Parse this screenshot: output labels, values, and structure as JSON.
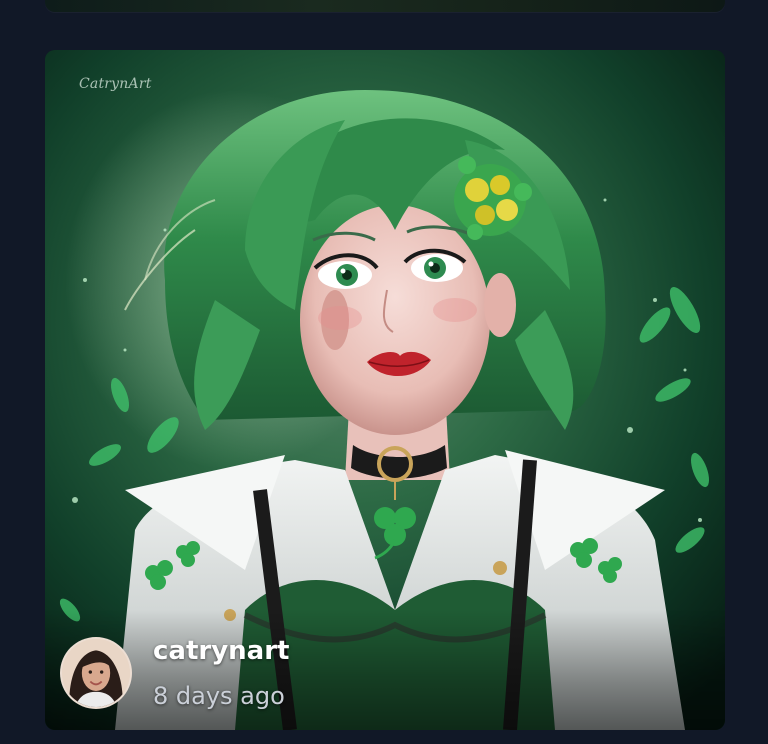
{
  "post": {
    "watermark": "CatrynArt",
    "author": "catrynart",
    "time_ago": "8 days ago",
    "artwork_icon": "digital-painting-green-haired-girl-with-shamrocks",
    "avatar_icon": "author-avatar-photo"
  },
  "colors": {
    "page_background": "#111827",
    "card_background": "#0b2a1d",
    "accent_green": "#2fa84f"
  }
}
